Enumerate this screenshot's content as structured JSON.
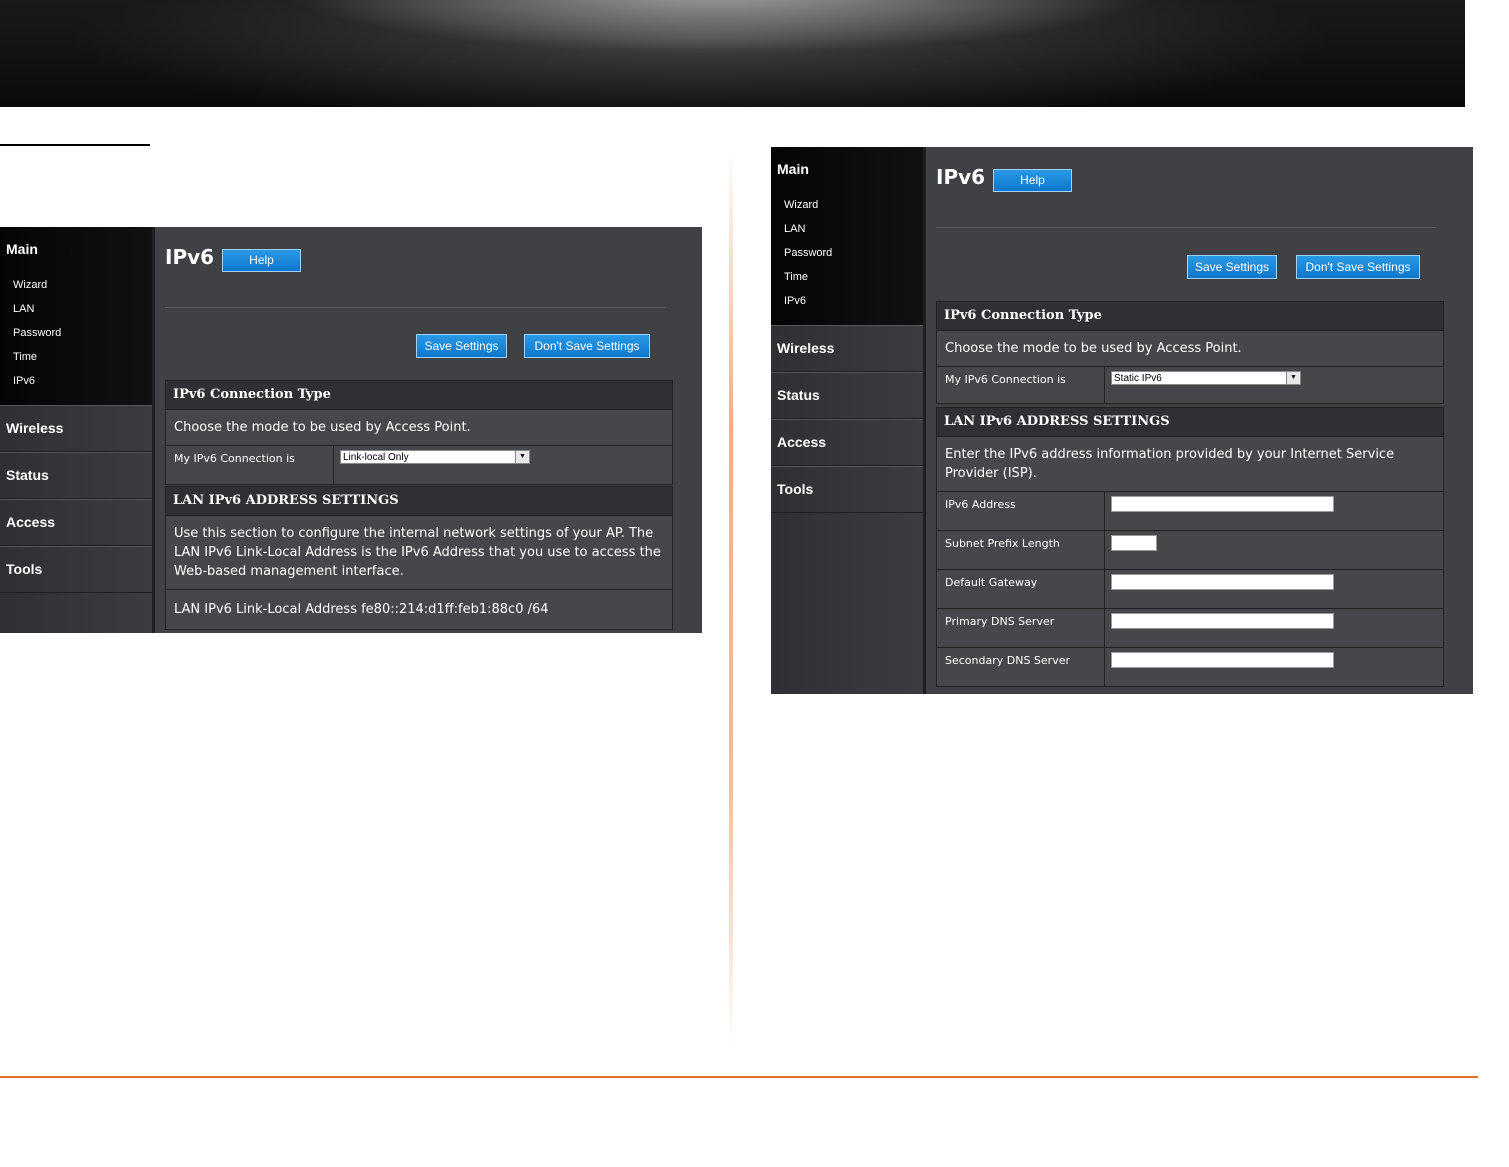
{
  "left_panel": {
    "sidebar": {
      "main_title": "Main",
      "sub_items": [
        "Wizard",
        "LAN",
        "Password",
        "Time",
        "IPv6"
      ],
      "nav_items": [
        "Wireless",
        "Status",
        "Access",
        "Tools"
      ]
    },
    "heading": "IPv6",
    "help_label": "Help",
    "save_label": "Save Settings",
    "dont_save_label": "Don't Save Settings",
    "connection_section": {
      "title": "IPv6 Connection Type",
      "description": "Choose the mode to be used by Access Point.",
      "label": "My IPv6 Connection is",
      "selected": "Link-local Only"
    },
    "lan_section": {
      "title": "LAN IPv6 ADDRESS SETTINGS",
      "description": "Use this section to configure the internal network settings of your AP. The LAN IPv6 Link-Local Address is the IPv6 Address that you use to access the Web-based management interface.",
      "link_local": "LAN IPv6 Link-Local Address fe80::214:d1ff:feb1:88c0 /64"
    }
  },
  "right_panel": {
    "sidebar": {
      "main_title": "Main",
      "sub_items": [
        "Wizard",
        "LAN",
        "Password",
        "Time",
        "IPv6"
      ],
      "nav_items": [
        "Wireless",
        "Status",
        "Access",
        "Tools"
      ]
    },
    "heading": "IPv6",
    "help_label": "Help",
    "save_label": "Save Settings",
    "dont_save_label": "Don't Save Settings",
    "connection_section": {
      "title": "IPv6 Connection Type",
      "description": "Choose the mode to be used by Access Point.",
      "label": "My IPv6 Connection is",
      "selected": "Static IPv6"
    },
    "lan_section": {
      "title": "LAN IPv6 ADDRESS SETTINGS",
      "description": "Enter the IPv6 address information provided by your Internet Service Provider (ISP).",
      "fields": [
        "IPv6 Address",
        "Subnet Prefix Length",
        "Default Gateway",
        "Primary DNS Server",
        "Secondary DNS Server"
      ]
    }
  }
}
